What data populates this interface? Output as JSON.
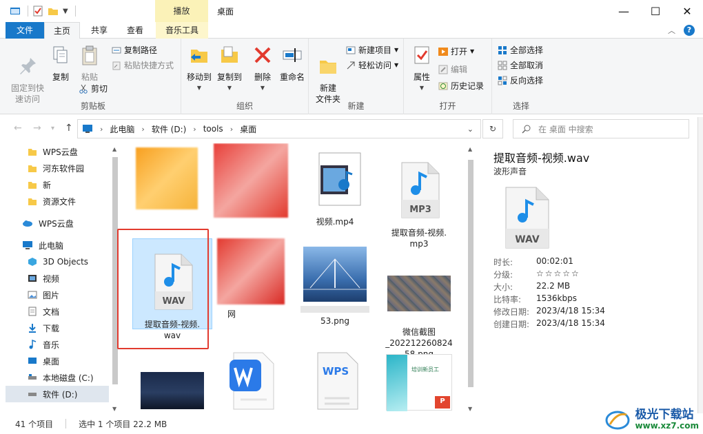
{
  "window": {
    "title": "桌面",
    "context_tab_group": "播放",
    "buttons": {
      "minimize": "—",
      "maximize": "☐",
      "close": "✕"
    }
  },
  "tabs": {
    "file": "文件",
    "home": "主页",
    "share": "共享",
    "view": "查看",
    "music_tools": "音乐工具"
  },
  "ribbon": {
    "clipboard": {
      "label": "剪贴板",
      "pin": "固定到快\n速访问",
      "copy": "复制",
      "paste": "粘贴",
      "copy_path": "复制路径",
      "paste_shortcut": "粘贴快捷方式",
      "cut": "剪切"
    },
    "organize": {
      "label": "组织",
      "move_to": "移动到",
      "copy_to": "复制到",
      "delete": "删除",
      "rename": "重命名"
    },
    "new": {
      "label": "新建",
      "new_folder": "新建\n文件夹",
      "new_item": "新建项目",
      "easy_access": "轻松访问"
    },
    "open": {
      "label": "打开",
      "properties": "属性",
      "open": "打开",
      "edit": "编辑",
      "history": "历史记录"
    },
    "select": {
      "label": "选择",
      "select_all": "全部选择",
      "select_none": "全部取消",
      "invert": "反向选择"
    }
  },
  "address": {
    "crumbs": [
      "此电脑",
      "软件 (D:)",
      "tools",
      "桌面"
    ],
    "search_placeholder": "在 桌面 中搜索"
  },
  "nav": {
    "items": [
      {
        "label": "WPS云盘",
        "icon": "folder-icon"
      },
      {
        "label": "河东软件园",
        "icon": "folder-icon"
      },
      {
        "label": "新",
        "icon": "folder-icon"
      },
      {
        "label": "资源文件",
        "icon": "folder-icon"
      },
      {
        "label": "WPS云盘",
        "icon": "cloud-icon"
      },
      {
        "label": "此电脑",
        "icon": "pc-icon"
      },
      {
        "label": "3D Objects",
        "icon": "3d-icon"
      },
      {
        "label": "视频",
        "icon": "video-icon"
      },
      {
        "label": "图片",
        "icon": "picture-icon"
      },
      {
        "label": "文档",
        "icon": "document-icon"
      },
      {
        "label": "下载",
        "icon": "download-icon"
      },
      {
        "label": "音乐",
        "icon": "music-icon"
      },
      {
        "label": "桌面",
        "icon": "desktop-icon"
      },
      {
        "label": "本地磁盘 (C:)",
        "icon": "drive-icon"
      },
      {
        "label": "软件 (D:)",
        "icon": "drive-icon"
      }
    ]
  },
  "files": {
    "video_mp4": "视频.mp4",
    "mp3": "提取音频-视频.\nmp3",
    "wav": "提取音频-视频.\nwav",
    "wangyi": "网",
    "png_53": "53.png",
    "wechat_png": "微信截图\n_202212260824\n58.png",
    "wav_badge": "WAV",
    "mp3_badge": "MP3",
    "wps_badge": "WPS",
    "train_doc": "培训新员工"
  },
  "details": {
    "name": "提取音频-视频.wav",
    "type": "波形声音",
    "props": [
      {
        "k": "时长:",
        "v": "00:02:01"
      },
      {
        "k": "分级:",
        "v": "☆☆☆☆☆"
      },
      {
        "k": "大小:",
        "v": "22.2 MB"
      },
      {
        "k": "比特率:",
        "v": "1536kbps"
      },
      {
        "k": "修改日期:",
        "v": "2023/4/18 15:34"
      },
      {
        "k": "创建日期:",
        "v": "2023/4/18 15:34"
      }
    ]
  },
  "status": {
    "count": "41 个项目",
    "selected": "选中 1 个项目  22.2 MB"
  },
  "watermark": {
    "name": "极光下载站",
    "url": "www.xz7.com"
  },
  "colors": {
    "accent": "#1979ca",
    "selection": "#cce8ff",
    "highlight_box": "#e23a2e",
    "context_tab": "#fbf2b8"
  }
}
